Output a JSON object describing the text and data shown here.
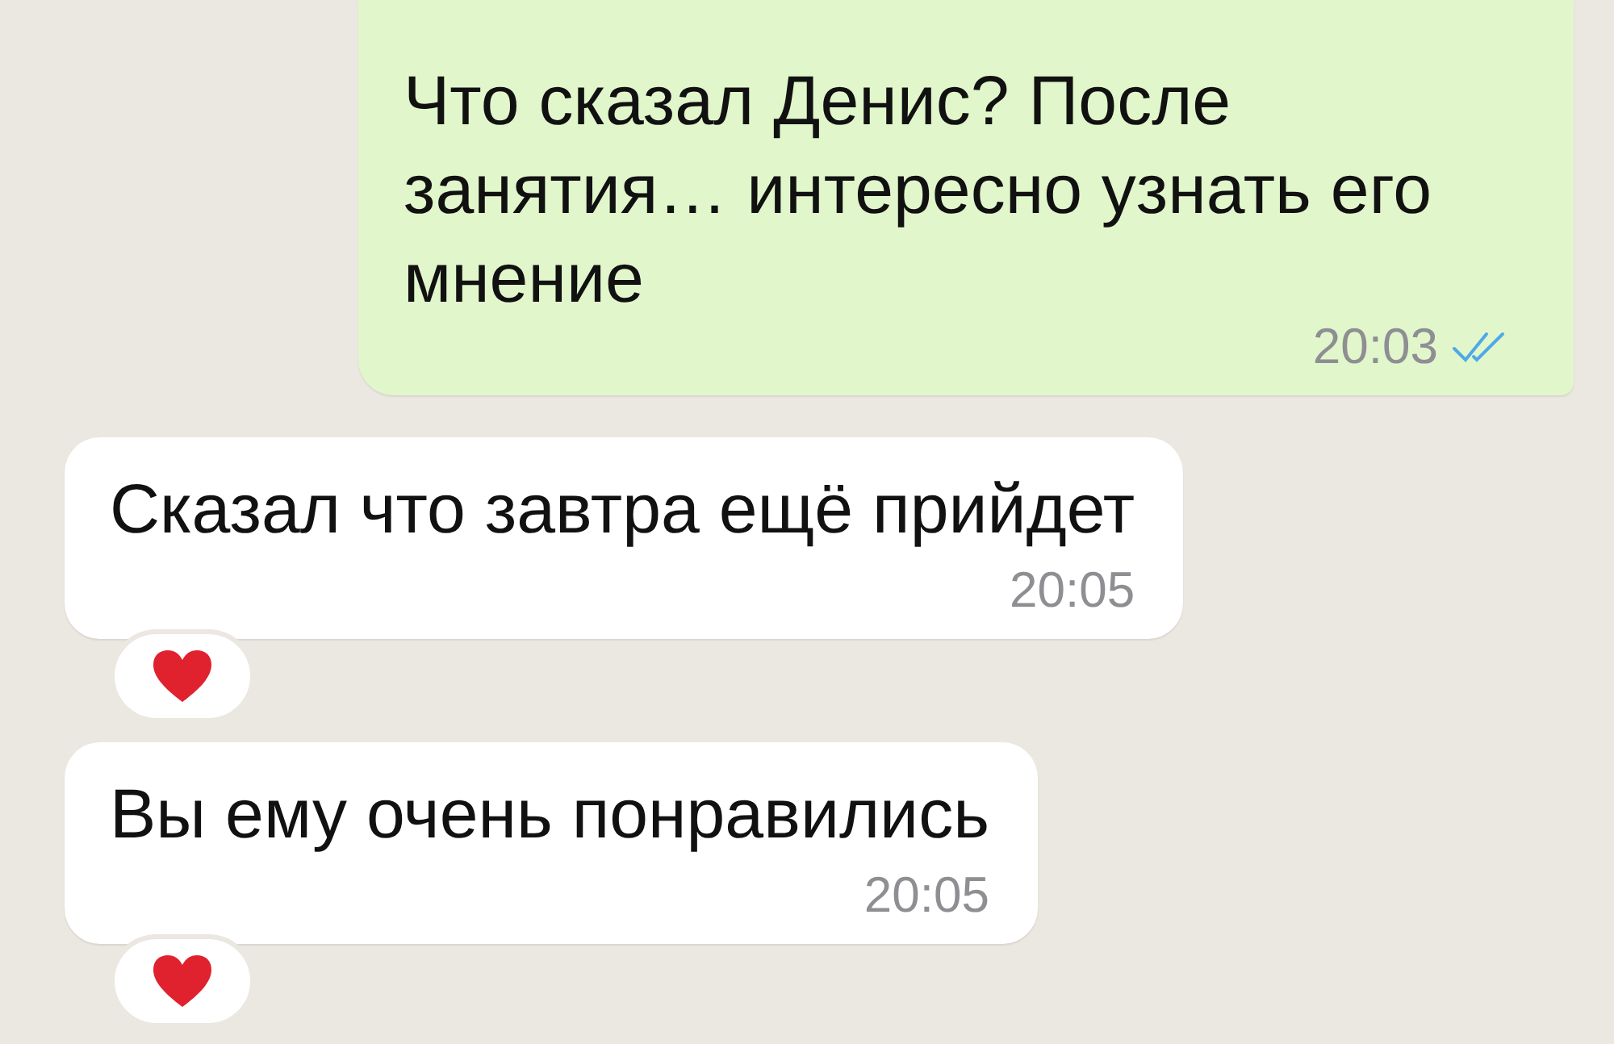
{
  "messages": [
    {
      "kind": "outgoing",
      "text": "Что сказал Денис? После занятия… интересно узнать его мнение",
      "time": "20:03",
      "read": true
    },
    {
      "kind": "incoming",
      "text": "Сказал что завтра ещё прийдет",
      "time": "20:05",
      "reaction": {
        "kind": "heart"
      }
    },
    {
      "kind": "incoming",
      "text": "Вы ему очень понравились",
      "time": "20:05",
      "reaction": {
        "kind": "heart"
      }
    }
  ]
}
